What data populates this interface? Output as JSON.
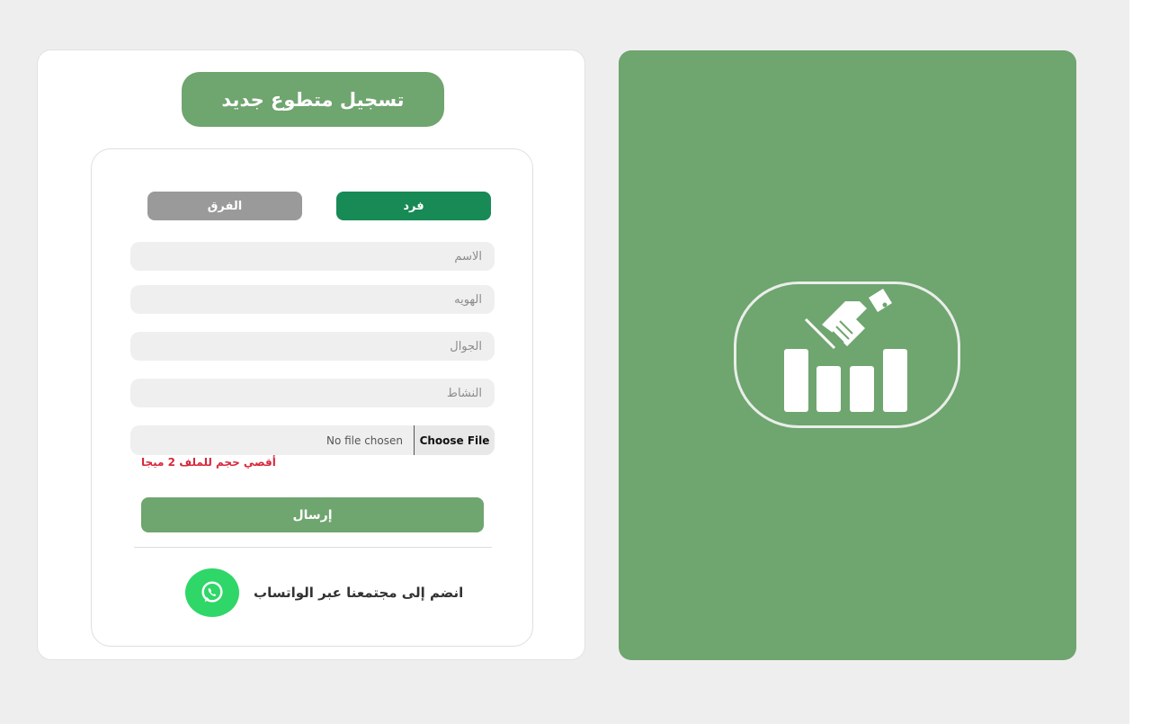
{
  "form": {
    "title": "تسجيل متطوع جديد",
    "tabs": {
      "individual": "فرد",
      "teams": "الفرق"
    },
    "fields": {
      "name_placeholder": "الاسم",
      "id_placeholder": "الهويه",
      "mobile_placeholder": "الجوال",
      "activity_placeholder": "النشاط"
    },
    "file": {
      "button_label": "Choose File",
      "status": "No file chosen",
      "hint": "أقصي حجم للملف 2 ميجا"
    },
    "submit_label": "إرسال",
    "whatsapp_text": "انضم إلى مجتمعنا عبر الواتساب"
  },
  "colors": {
    "brand_green": "#6fa56f",
    "active_tab": "#188a55",
    "inactive_tab": "#9a9a9a",
    "whatsapp": "#2fd668",
    "hint_red": "#d8273b"
  },
  "icons": {
    "whatsapp": "whatsapp-icon",
    "logo": "handshake-bar-chart-icon"
  }
}
